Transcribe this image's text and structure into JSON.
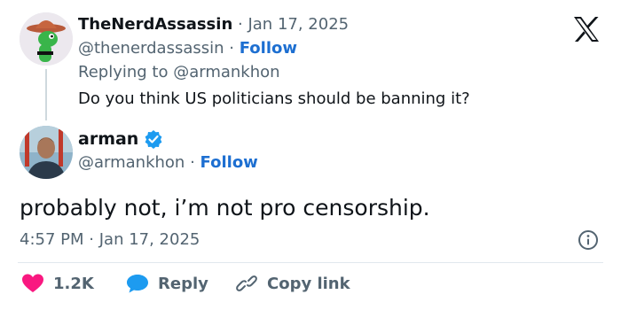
{
  "reply_tweet": {
    "display_name": "TheNerdAssassin",
    "date": "Jan 17, 2025",
    "handle": "@thenerdassassin",
    "follow": "Follow",
    "replying_to_prefix": "Replying to",
    "replying_to_handle": "@armankhon",
    "text": "Do you think US politicians should be banning it?"
  },
  "main_tweet": {
    "display_name": "arman",
    "verified": true,
    "handle": "@armankhon",
    "follow": "Follow",
    "text": "probably not, i’m not pro censorship.",
    "time": "4:57 PM",
    "date": "Jan 17, 2025"
  },
  "actions": {
    "likes": "1.2K",
    "reply": "Reply",
    "copy_link": "Copy link"
  },
  "separator": "·",
  "colors": {
    "link": "#1d6fd1",
    "like": "#f91880",
    "verified": "#1d9bf0"
  },
  "icons": [
    "x-logo-icon",
    "verified-badge-icon",
    "info-icon",
    "heart-icon",
    "reply-bubble-icon",
    "link-icon"
  ]
}
